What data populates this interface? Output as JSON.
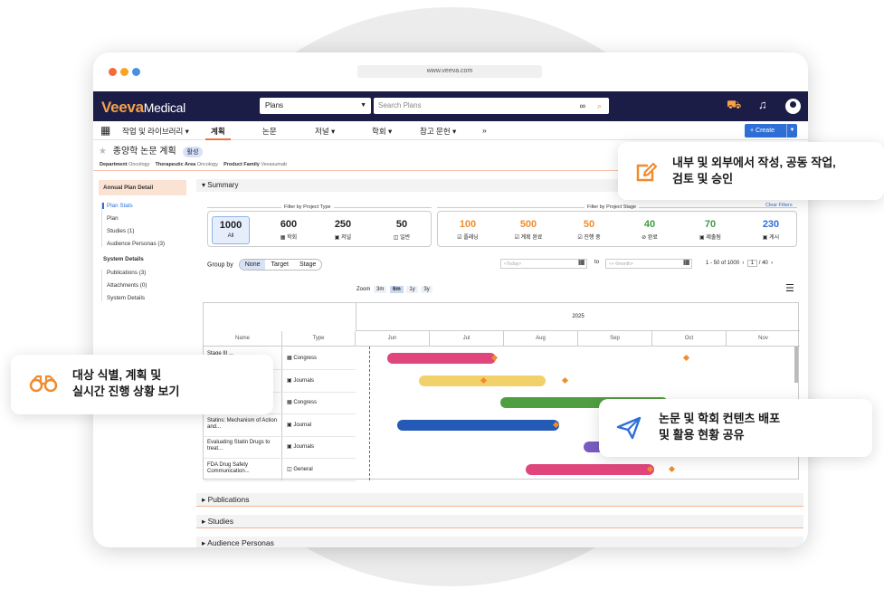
{
  "browser": {
    "url": "www.veeva.com",
    "dots": [
      "#f26b3a",
      "#f5a623",
      "#4a90e2"
    ]
  },
  "topbar": {
    "logo_brand": "Veeva",
    "logo_product": "Medical",
    "object_select": "Plans",
    "search_placeholder": "Search Plans",
    "icons": [
      "binoculars-icon",
      "search-icon",
      "cart-icon",
      "bell-icon",
      "user-avatar"
    ]
  },
  "nav": {
    "items": [
      "작업 및 라이브러리 ▾",
      "계획",
      "논문",
      "저널 ▾",
      "학회 ▾",
      "참고 문헌 ▾",
      "»"
    ],
    "active": "계획",
    "create": "+ Create"
  },
  "record": {
    "title": "종양학 논문 계획",
    "status": "활성",
    "meta": [
      {
        "label": "Department",
        "value": "Oncology"
      },
      {
        "label": "Therapeutic Area",
        "value": "Oncology"
      },
      {
        "label": "Product Family",
        "value": "Vevasumab"
      }
    ]
  },
  "leftnav": {
    "header": "Annual Plan Detail",
    "plan_items": [
      "Plan Stats",
      "Plan",
      "Studies (1)",
      "Audience Personas (3)"
    ],
    "system_header": "System Details",
    "system_items": [
      "Publications (3)",
      "Attachments (0)",
      "System Details"
    ]
  },
  "summary": {
    "section": "▾ Summary",
    "project_type_label": "Filter by Project Type",
    "project_stage_label": "Filter by Project Stage",
    "clear_filters": "Clear Filters",
    "type_stats": [
      {
        "num": "1000",
        "label": "All",
        "color": "#222222"
      },
      {
        "num": "600",
        "label": "▦ 학회",
        "color": "#222222"
      },
      {
        "num": "250",
        "label": "▣ 저널",
        "color": "#222222"
      },
      {
        "num": "50",
        "label": "◫ 일반",
        "color": "#222222"
      }
    ],
    "stage_stats": [
      {
        "num": "100",
        "label": "☑ 플래닝",
        "color": "#f08c2e"
      },
      {
        "num": "500",
        "label": "☑ 계획 완료",
        "color": "#f08c2e"
      },
      {
        "num": "50",
        "label": "☑ 진행 중",
        "color": "#f08c2e"
      },
      {
        "num": "40",
        "label": "⊘ 완료",
        "color": "#3f9b3f"
      },
      {
        "num": "70",
        "label": "▣ 제출됨",
        "color": "#3f9b3f"
      },
      {
        "num": "230",
        "label": "▣ 게시",
        "color": "#2f6fd6"
      }
    ]
  },
  "controls": {
    "group_by_label": "Group by",
    "group_options": [
      "None",
      "Target",
      "Stage"
    ],
    "group_selected": "None",
    "date_from": "<Today>",
    "to_label": "to",
    "date_to": "<+ 6month>",
    "range": "1 - 50 of 1000",
    "page": "1",
    "page_total": "/ 40",
    "zoom_label": "Zoom",
    "zoom_options": [
      "3m",
      "6m",
      "1y",
      "3y"
    ],
    "zoom_selected": "6m"
  },
  "gantt": {
    "col_name": "Name",
    "col_type": "Type",
    "year": "2025",
    "months": [
      "Jun",
      "Jul",
      "Aug",
      "Sep",
      "Oct",
      "Nov"
    ],
    "rows": [
      {
        "name": "Stage III ...",
        "type": "Congress"
      },
      {
        "name": "",
        "type": "Journals"
      },
      {
        "name": "",
        "type": "Congress"
      },
      {
        "name": "Statins: Mechanism of Action and...",
        "type": "Journal"
      },
      {
        "name": "Evaluating Statin Drugs to treat...",
        "type": "Journals"
      },
      {
        "name": "FDA Drug Safety Communication...",
        "type": "General"
      }
    ],
    "bar_colors": [
      "#e0467c",
      "#f2d16b",
      "#4f9e3f",
      "#2459b5",
      "#7a5cc2",
      "#e0467c"
    ]
  },
  "accordions": [
    "▸ Publications",
    "▸ Studies",
    "▸ Audience Personas"
  ],
  "callouts": {
    "author": "내부 및 외부에서 작성, 공동 작업,\n검토 및 승인",
    "track": "대상 식별, 계획 및\n실시간 진행 상황 보기",
    "share": "논문 및 학회 컨텐츠 배포\n및 활용 현황 공유",
    "accent": "#f08c2e"
  }
}
